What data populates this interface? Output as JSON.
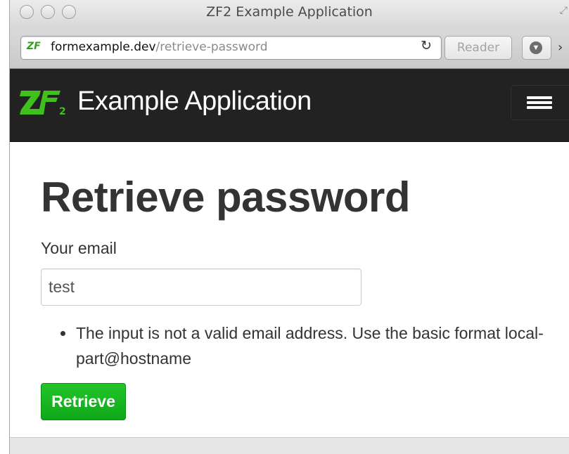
{
  "window": {
    "title": "ZF2 Example Application"
  },
  "addressbar": {
    "favicon_text": "ZF",
    "url_domain": "formexample.dev",
    "url_path": "/retrieve-password",
    "reader_label": "Reader"
  },
  "navbar": {
    "logo_text": "ZF2",
    "brand": "Example Application"
  },
  "main": {
    "title": "Retrieve password",
    "email_label": "Your email",
    "email_value": "test",
    "errors": [
      "The input is not a valid email address. Use the basic format local-part@hostname"
    ],
    "submit_label": "Retrieve"
  },
  "colors": {
    "navbar_bg": "#222222",
    "button_green": "#11b01a",
    "logo_green": "#3fc01d"
  }
}
